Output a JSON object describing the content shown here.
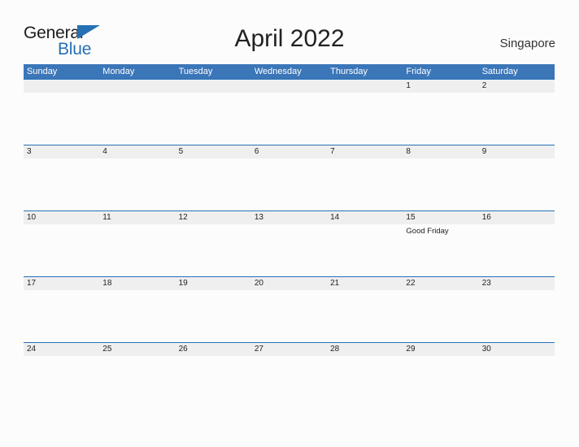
{
  "brand": {
    "name_top": "General",
    "name_bottom": "Blue",
    "flag_icon": "blue-triangle-flag-icon",
    "color_blue": "#2670b5",
    "color_text": "#1c1c1c"
  },
  "header": {
    "title": "April 2022",
    "location": "Singapore"
  },
  "theme": {
    "header_bar": "#3b76b8",
    "row_rule": "#2670b5",
    "date_band": "#efefef",
    "page_background": "#fcfcfc"
  },
  "calendar": {
    "month": "April",
    "year": "2022",
    "weekdays": [
      "Sunday",
      "Monday",
      "Tuesday",
      "Wednesday",
      "Thursday",
      "Friday",
      "Saturday"
    ],
    "weeks": [
      [
        {
          "date": "",
          "event": ""
        },
        {
          "date": "",
          "event": ""
        },
        {
          "date": "",
          "event": ""
        },
        {
          "date": "",
          "event": ""
        },
        {
          "date": "",
          "event": ""
        },
        {
          "date": "1",
          "event": ""
        },
        {
          "date": "2",
          "event": ""
        }
      ],
      [
        {
          "date": "3",
          "event": ""
        },
        {
          "date": "4",
          "event": ""
        },
        {
          "date": "5",
          "event": ""
        },
        {
          "date": "6",
          "event": ""
        },
        {
          "date": "7",
          "event": ""
        },
        {
          "date": "8",
          "event": ""
        },
        {
          "date": "9",
          "event": ""
        }
      ],
      [
        {
          "date": "10",
          "event": ""
        },
        {
          "date": "11",
          "event": ""
        },
        {
          "date": "12",
          "event": ""
        },
        {
          "date": "13",
          "event": ""
        },
        {
          "date": "14",
          "event": ""
        },
        {
          "date": "15",
          "event": "Good Friday"
        },
        {
          "date": "16",
          "event": ""
        }
      ],
      [
        {
          "date": "17",
          "event": ""
        },
        {
          "date": "18",
          "event": ""
        },
        {
          "date": "19",
          "event": ""
        },
        {
          "date": "20",
          "event": ""
        },
        {
          "date": "21",
          "event": ""
        },
        {
          "date": "22",
          "event": ""
        },
        {
          "date": "23",
          "event": ""
        }
      ],
      [
        {
          "date": "24",
          "event": ""
        },
        {
          "date": "25",
          "event": ""
        },
        {
          "date": "26",
          "event": ""
        },
        {
          "date": "27",
          "event": ""
        },
        {
          "date": "28",
          "event": ""
        },
        {
          "date": "29",
          "event": ""
        },
        {
          "date": "30",
          "event": ""
        }
      ]
    ]
  }
}
